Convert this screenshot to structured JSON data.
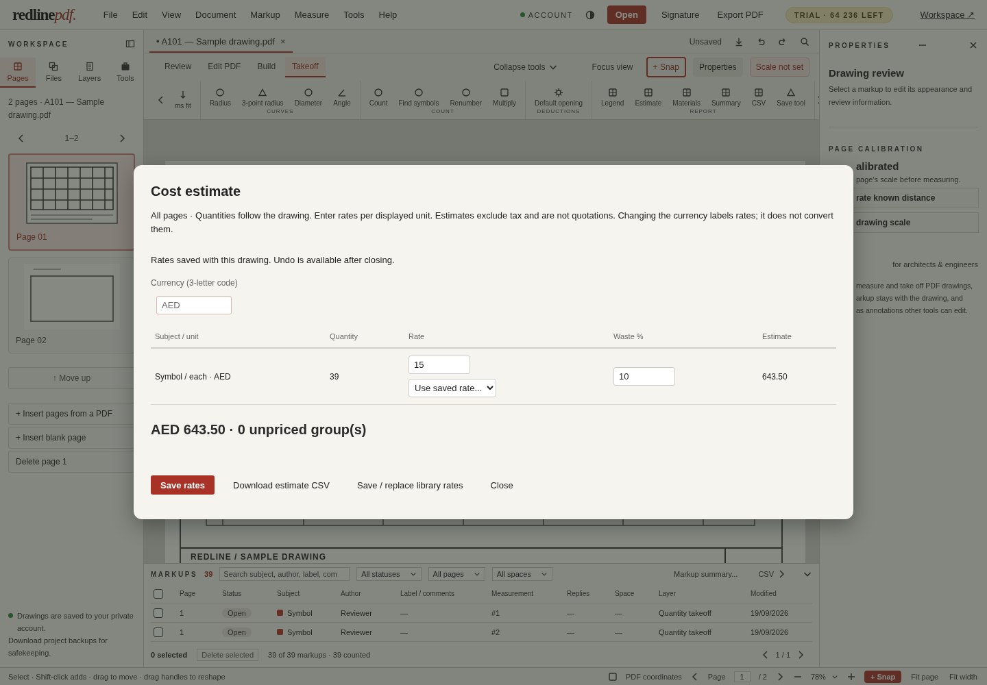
{
  "top_bar": {
    "logo": {
      "word": "redline",
      "suffix": "pdf."
    },
    "menu": [
      "File",
      "Edit",
      "View",
      "Document",
      "Markup",
      "Measure",
      "Tools",
      "Help"
    ],
    "account": {
      "label": "ACCOUNT",
      "online": true
    },
    "buttons": [
      {
        "label": "Open",
        "kind": "primary"
      },
      {
        "label": "Signature",
        "kind": "plain"
      },
      {
        "label": "Export PDF",
        "kind": "plain"
      }
    ],
    "trial_badge": "TRIAL · 64 236 LEFT",
    "workspace_link": "Workspace ↗"
  },
  "sidebar": {
    "title": "WORKSPACE",
    "tabs": [
      {
        "label": "Pages",
        "selected": true
      },
      {
        "label": "Files",
        "selected": false
      },
      {
        "label": "Layers",
        "selected": false
      },
      {
        "label": "Tools",
        "selected": false
      }
    ],
    "summary": "2 pages · A101 — Sample drawing.pdf",
    "pager": "1–2",
    "pages": [
      {
        "label": "Page 01",
        "selected": true,
        "kind": "plan"
      },
      {
        "label": "Page 02",
        "selected": false,
        "kind": "sheet"
      }
    ],
    "actions": [
      {
        "label": "↑ Move up",
        "disabled": true
      },
      {
        "label": "+ Insert pages from a PDF",
        "disabled": false
      },
      {
        "label": "+ Insert blank page",
        "disabled": false
      },
      {
        "label": "Delete page 1",
        "disabled": false
      }
    ],
    "notes": [
      "Drawings are saved to your private account.",
      "Download project backups for safekeeping."
    ]
  },
  "document": {
    "tab": {
      "label": "• A101 — Sample drawing.pdf",
      "close": "×",
      "selected": true
    },
    "save_state": "Unsaved",
    "modes": [
      {
        "label": "Review",
        "selected": false
      },
      {
        "label": "Edit PDF",
        "selected": false
      },
      {
        "label": "Build",
        "selected": false
      },
      {
        "label": "Takeoff",
        "selected": true
      }
    ],
    "view_buttons": [
      {
        "label": "Collapse tools",
        "kind": "menu"
      },
      {
        "label": "Focus view",
        "kind": "plain"
      },
      {
        "label": "+ Snap",
        "kind": "active"
      },
      {
        "label": "Properties",
        "kind": "boxed"
      },
      {
        "label": "Scale not set",
        "kind": "warning"
      }
    ],
    "ribbon": [
      {
        "tools": [
          "ms fit"
        ]
      },
      {
        "label": "CURVES",
        "tools": [
          "Radius",
          "3-point radius",
          "Diameter",
          "Angle"
        ]
      },
      {
        "label": "COUNT",
        "tools": [
          "Count",
          "Find symbols",
          "Renumber",
          "Multiply"
        ]
      },
      {
        "label": "DEDUCTIONS",
        "tools": [
          "Default opening"
        ]
      },
      {
        "label": "REPORT",
        "tools": [
          "Legend",
          "Estimate",
          "Materials",
          "Summary",
          "CSV",
          "Save tool"
        ]
      }
    ],
    "sheet_title": "REDLINE / SAMPLE DRAWING"
  },
  "properties": {
    "title": "PROPERTIES",
    "heading": "Drawing review",
    "hint": "Select a markup to edit its appearance and review information.",
    "calibration": {
      "title": "PAGE CALIBRATION",
      "status": "alibrated",
      "hint": "page's scale before measuring.",
      "actions": [
        "rate known distance",
        "drawing scale"
      ]
    },
    "tagline": "for architects & engineers",
    "about": [
      "measure and take off PDF drawings,",
      "arkup stays with the drawing, and",
      "as annotations other tools can edit."
    ]
  },
  "markups": {
    "title": "MARKUPS",
    "count": "39",
    "search": {
      "placeholder": "Search subject, author, label, com"
    },
    "filters": [
      "All statuses",
      "All pages",
      "All spaces"
    ],
    "summary_button": "Markup summary...",
    "export_button": "CSV",
    "all_checked": false,
    "columns": [
      "Page",
      "Status",
      "Subject",
      "Author",
      "Label / comments",
      "Measurement",
      "Replies",
      "Space",
      "Layer",
      "Modified"
    ],
    "rows": [
      {
        "checked": false,
        "page": "1",
        "status": "Open",
        "subject": "Symbol",
        "author": "Reviewer",
        "comment": "—",
        "measurement": "#1",
        "replies": "—",
        "space": "—",
        "layer": "Quantity takeoff",
        "modified": "19/09/2026"
      },
      {
        "checked": false,
        "page": "1",
        "status": "Open",
        "subject": "Symbol",
        "author": "Reviewer",
        "comment": "—",
        "measurement": "#2",
        "replies": "—",
        "space": "—",
        "layer": "Quantity takeoff",
        "modified": "19/09/2026"
      }
    ],
    "selection": "0 selected",
    "delete_button": {
      "label": "Delete selected",
      "disabled": true
    },
    "result_count": "39 of 39 markups · 39 counted",
    "pager": "1 / 1"
  },
  "status_bar": {
    "hint": "Select · Shift-click adds · drag to move · drag handles to reshape",
    "coordinates": "PDF coordinates",
    "page_label": "Page",
    "page": "1",
    "page_total": "/ 2",
    "zoom": "78%",
    "snap": {
      "label": "+ Snap",
      "on": true
    },
    "fit": [
      "Fit page",
      "Fit width"
    ]
  },
  "dialog": {
    "title": "Cost estimate",
    "description": "All pages · Quantities follow the drawing. Enter rates per displayed unit. Estimates exclude tax and are not quotations. Changing the currency labels rates; it does not convert them.",
    "save_note": "Rates saved with this drawing. Undo is available after closing.",
    "currency": {
      "label": "Currency (3-letter code)",
      "placeholder": "AED"
    },
    "columns": [
      "Subject / unit",
      "Quantity",
      "Rate",
      "Waste %",
      "Estimate"
    ],
    "rows": [
      {
        "subject": "Symbol / each · AED",
        "quantity": "39",
        "rate": "15",
        "rate_preset": "Use saved rate...",
        "waste": "10",
        "estimate": "643.50"
      }
    ],
    "total": "AED 643.50 · 0 unpriced group(s)",
    "buttons": [
      {
        "label": "Save rates",
        "kind": "primary"
      },
      {
        "label": "Download estimate CSV",
        "kind": "link"
      },
      {
        "label": "Save / replace library rates",
        "kind": "link"
      },
      {
        "label": "Close",
        "kind": "link"
      }
    ]
  }
}
